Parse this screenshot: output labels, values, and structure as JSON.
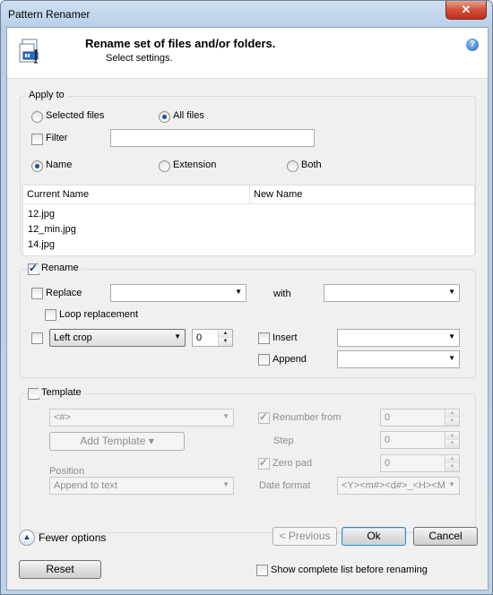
{
  "window": {
    "title": "Pattern Renamer",
    "close_glyph": "✕"
  },
  "header": {
    "title": "Rename set of files and/or folders.",
    "subtitle": "Select settings.",
    "help_glyph": "?"
  },
  "apply_to": {
    "label": "Apply to",
    "selected_files": "Selected files",
    "all_files": "All files",
    "filter": "Filter",
    "filter_value": "",
    "name": "Name",
    "extension": "Extension",
    "both": "Both"
  },
  "file_list": {
    "columns": [
      "Current Name",
      "New Name"
    ],
    "rows": [
      {
        "current": "12.jpg",
        "new": ""
      },
      {
        "current": "12_min.jpg",
        "new": ""
      },
      {
        "current": "14.jpg",
        "new": ""
      }
    ]
  },
  "rename": {
    "label": "Rename",
    "checked": true,
    "replace": "Replace",
    "replace_value": "",
    "with": "with",
    "with_value": "",
    "loop_replacement": "Loop replacement",
    "crop_mode": "Left crop",
    "crop_count": "0",
    "insert": "Insert",
    "insert_value": "",
    "append": "Append",
    "append_value": ""
  },
  "template": {
    "label": "Template",
    "template_value": "<#>",
    "add_template": "Add Template ▾",
    "position_label": "Position",
    "position_value": "Append to text",
    "renumber_from": "Renumber from",
    "renumber_value": "0",
    "step": "Step",
    "step_value": "0",
    "zero_pad": "Zero pad",
    "zero_pad_value": "0",
    "date_format": "Date format",
    "date_format_value": "<Y><m#><d#>_<H><M>"
  },
  "footer": {
    "fewer_options": "Fewer options",
    "previous": "< Previous",
    "ok": "Ok",
    "cancel": "Cancel",
    "reset": "Reset",
    "show_complete_list": "Show complete list before renaming"
  },
  "icons": {
    "help": "help-icon",
    "close": "close-icon",
    "app": "files-rename-icon",
    "fewer": "chevron-up-circle-icon"
  },
  "colors": {
    "accent": "#2a6ac0",
    "close": "#c0301a"
  }
}
